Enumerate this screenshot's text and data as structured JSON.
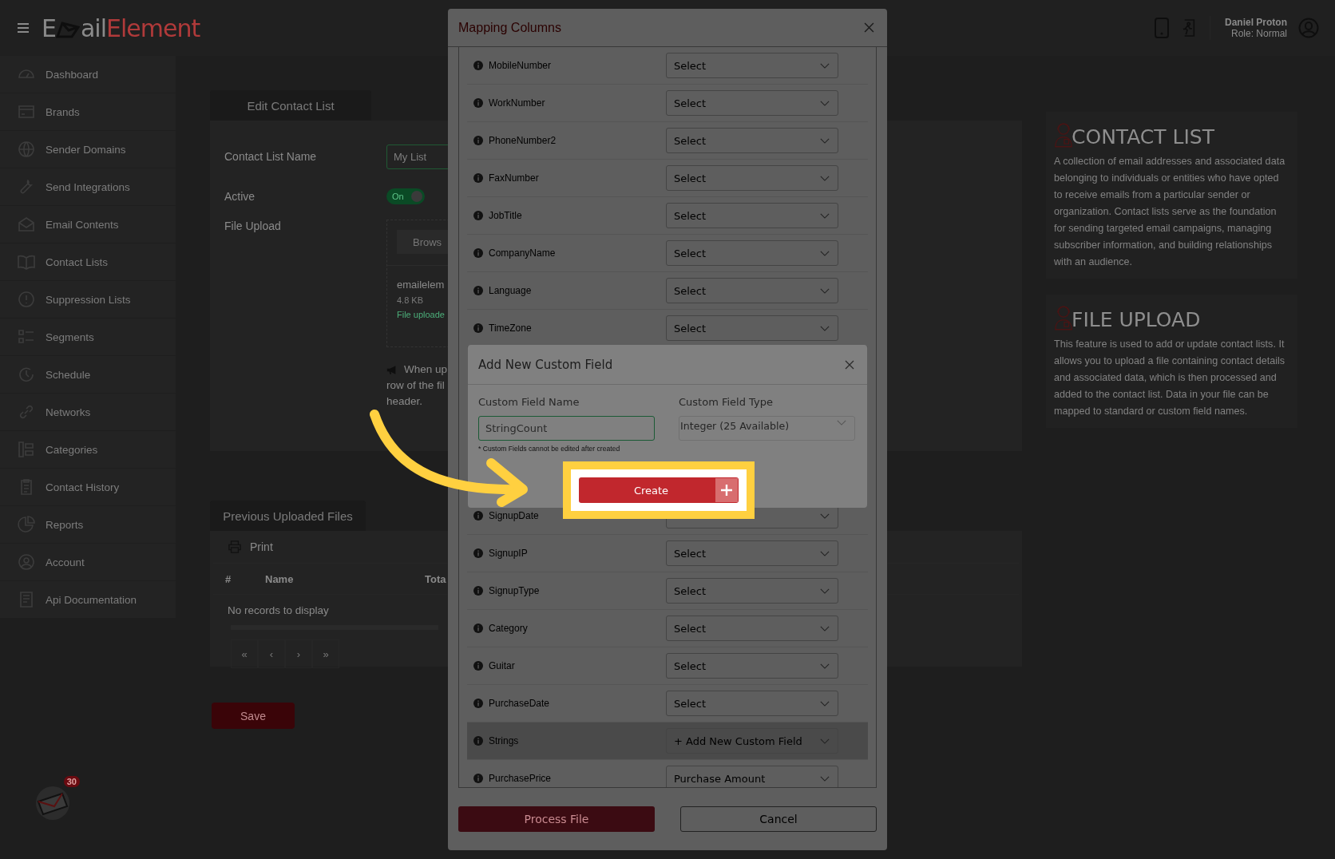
{
  "header": {
    "logo": [
      "E",
      "ail",
      "Element"
    ],
    "user_name": "Daniel Proton",
    "user_role": "Role: Normal"
  },
  "sidebar": {
    "items": [
      {
        "label": "Dashboard"
      },
      {
        "label": "Brands"
      },
      {
        "label": "Sender Domains"
      },
      {
        "label": "Send Integrations"
      },
      {
        "label": "Email Contents"
      },
      {
        "label": "Contact Lists"
      },
      {
        "label": "Suppression Lists"
      },
      {
        "label": "Segments"
      },
      {
        "label": "Schedule"
      },
      {
        "label": "Networks"
      },
      {
        "label": "Categories"
      },
      {
        "label": "Contact History"
      },
      {
        "label": "Reports"
      },
      {
        "label": "Account"
      },
      {
        "label": "Api Documentation"
      }
    ]
  },
  "mail_badge": "30",
  "edit_card": {
    "tab": "Edit Contact List",
    "name_label": "Contact List Name",
    "name_value": "My List",
    "active_label": "Active",
    "active_toggle": {
      "on": true,
      "label": "On"
    },
    "upload_label": "File Upload",
    "browse": "Brows",
    "file_name": "emailelem",
    "file_size": "4.8 KB",
    "file_status": "File uploade",
    "notice_lines": [
      "When up",
      "row of the fil",
      "header."
    ]
  },
  "files_card": {
    "tab": "Previous Uploaded Files",
    "print": "Print",
    "columns": [
      "#",
      "Name",
      "Tota"
    ],
    "empty": "No records to display",
    "pager": [
      "«",
      "‹",
      "›",
      "»"
    ]
  },
  "save": "Save",
  "info_panels": [
    {
      "title": "CONTACT LIST",
      "text": "A collection of email addresses and associated data belonging to individuals or entities who have opted to receive emails from a particular sender or organization. Contact lists serve as the foundation for sending targeted email campaigns, managing subscriber information, and building relationships with an audience."
    },
    {
      "title": "FILE UPLOAD",
      "text": "This feature is used to add or update contact lists. It allows you to upload a file containing contact details and associated data, which is then processed and added to the contact list. Data in your file can be mapped to standard or custom field names."
    }
  ],
  "mapping_modal": {
    "title": "Mapping Columns",
    "rows": [
      {
        "label": "MobileNumber",
        "value": "Select",
        "highlighted": false
      },
      {
        "label": "WorkNumber",
        "value": "Select",
        "highlighted": false
      },
      {
        "label": "PhoneNumber2",
        "value": "Select",
        "highlighted": false
      },
      {
        "label": "FaxNumber",
        "value": "Select",
        "highlighted": false
      },
      {
        "label": "JobTitle",
        "value": "Select",
        "highlighted": false
      },
      {
        "label": "CompanyName",
        "value": "Select",
        "highlighted": false
      },
      {
        "label": "Language",
        "value": "Select",
        "highlighted": false
      },
      {
        "label": "TimeZone",
        "value": "Select",
        "highlighted": false
      },
      {
        "label": "SignupDate",
        "highlighted": false
      },
      {
        "label": "SignupIP",
        "value": "Select",
        "highlighted": false
      },
      {
        "label": "SignupType",
        "value": "Select",
        "highlighted": false
      },
      {
        "label": "Category",
        "value": "Select",
        "highlighted": false
      },
      {
        "label": "Guitar",
        "value": "Select",
        "highlighted": false
      },
      {
        "label": "PurchaseDate",
        "value": "Select",
        "highlighted": false
      },
      {
        "label": "Strings",
        "value": "+ Add New Custom Field",
        "highlighted": true
      },
      {
        "label": "PurchasePrice",
        "value": "Purchase Amount",
        "highlighted": false
      }
    ],
    "process": "Process File",
    "cancel": "Cancel"
  },
  "custom_field_dialog": {
    "title": "Add New Custom Field",
    "name_label": "Custom Field Name",
    "name_value": "StringCount",
    "type_label": "Custom Field Type",
    "type_value": "Integer (25 Available)",
    "note": "* Custom Fields cannot be edited after created",
    "create": "Create"
  }
}
